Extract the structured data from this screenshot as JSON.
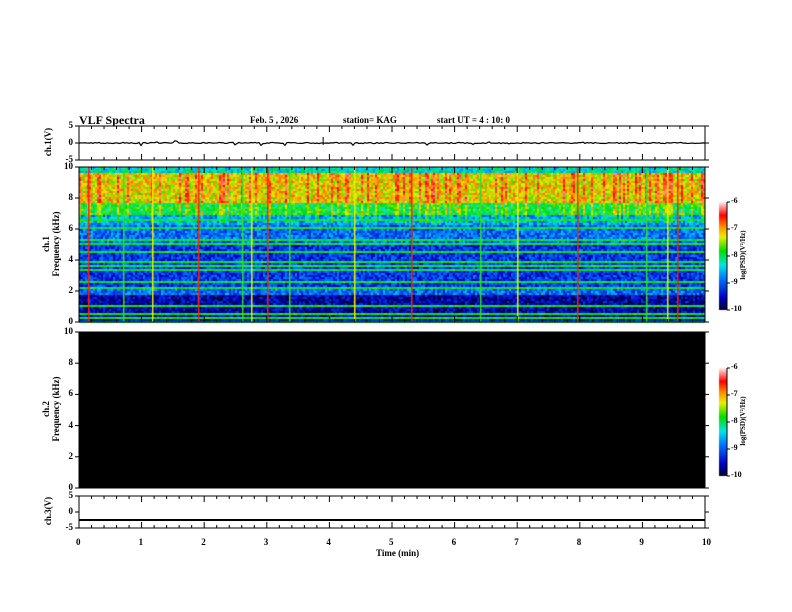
{
  "header": {
    "title": "VLF Spectra",
    "date": "Feb. 5  , 2026",
    "station": "station= KAG",
    "start": "start  UT =   4 : 10: 0"
  },
  "chart_data": {
    "type": "heatmap",
    "x": {
      "label": "Time  (min)",
      "range": [
        0,
        10
      ],
      "ticks": [
        "0",
        "1",
        "2",
        "3",
        "4",
        "5",
        "6",
        "7",
        "8",
        "9",
        "10"
      ]
    },
    "panels": [
      {
        "id": "ch1v",
        "type": "line",
        "ylabel": "ch.1(V)",
        "ylim": [
          -5,
          5
        ],
        "ticks": [
          "5",
          "0",
          "-5"
        ],
        "baseline": 0
      },
      {
        "id": "ch1",
        "type": "heatmap",
        "ylabel1": "ch.1",
        "ylabel2": "Frequency  (kHz)",
        "ylim": [
          0,
          10
        ],
        "ticks": [
          "10",
          "8",
          "6",
          "4",
          "2",
          "0"
        ],
        "colorbar": {
          "label": "log(PSD)(V²/Hz)",
          "range": [
            -10,
            -6
          ],
          "ticks": [
            "-6",
            "-7",
            "-8",
            "-9",
            "-10"
          ]
        },
        "narrowband_lines_khz": [
          0.3,
          0.6,
          1.1,
          2.3,
          2.6,
          3.4,
          3.7,
          3.9,
          4.6,
          5.1,
          5.3,
          6.1,
          6.7,
          7.0
        ],
        "impulse_times_min": [
          0.15,
          0.7,
          1.17,
          1.9,
          2.6,
          2.75,
          3.0,
          3.35,
          4.4,
          5.3,
          6.4,
          7.0,
          7.95,
          9.05,
          9.4,
          9.55
        ]
      },
      {
        "id": "ch2",
        "type": "heatmap",
        "ylabel1": "ch.2",
        "ylabel2": "Frequency  (kHz)",
        "ylim": [
          0,
          10
        ],
        "ticks": [
          "10",
          "8",
          "6",
          "4",
          "2",
          "0"
        ],
        "colorbar": {
          "label": "log(PSD)(V²/Hz)",
          "range": [
            -10,
            -6
          ],
          "ticks": [
            "-6",
            "-7",
            "-8",
            "-9",
            "-10"
          ]
        },
        "fill_value": -10
      },
      {
        "id": "ch3v",
        "type": "line",
        "ylabel": "ch.3(V)",
        "ylim": [
          -5,
          5
        ],
        "ticks": [
          "5",
          "0",
          "-5"
        ],
        "baseline": -2.5
      }
    ]
  }
}
